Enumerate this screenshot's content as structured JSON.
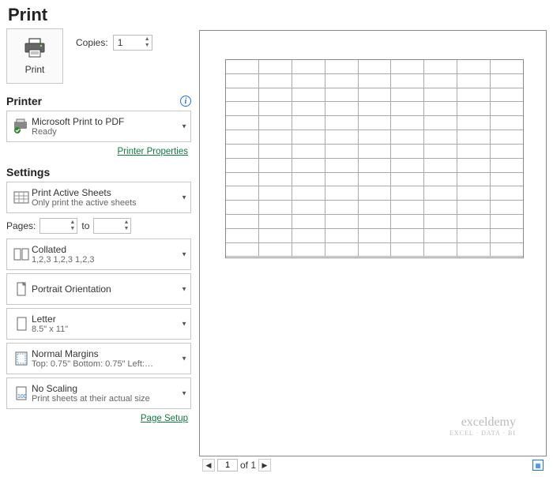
{
  "title": "Print",
  "printBtn": {
    "label": "Print"
  },
  "copies": {
    "label": "Copies:",
    "value": "1"
  },
  "printerSection": {
    "title": "Printer",
    "selected": {
      "name": "Microsoft Print to PDF",
      "status": "Ready"
    },
    "propertiesLink": "Printer Properties"
  },
  "settingsSection": {
    "title": "Settings",
    "printWhat": {
      "title": "Print Active Sheets",
      "sub": "Only print the active sheets"
    },
    "pages": {
      "label": "Pages:",
      "toLabel": "to",
      "from": "",
      "to": ""
    },
    "collate": {
      "title": "Collated",
      "sub": "1,2,3    1,2,3    1,2,3"
    },
    "orientation": {
      "title": "Portrait Orientation",
      "sub": ""
    },
    "paper": {
      "title": "Letter",
      "sub": "8.5\" x 11\""
    },
    "margins": {
      "title": "Normal Margins",
      "sub": "Top: 0.75\" Bottom: 0.75\" Left:…"
    },
    "scaling": {
      "title": "No Scaling",
      "sub": "Print sheets at their actual size"
    },
    "pageSetupLink": "Page Setup"
  },
  "preview": {
    "currentPage": "1",
    "totalLabel": "of 1"
  },
  "watermark": {
    "brand": "exceldemy",
    "tag": "EXCEL · DATA · BI"
  }
}
